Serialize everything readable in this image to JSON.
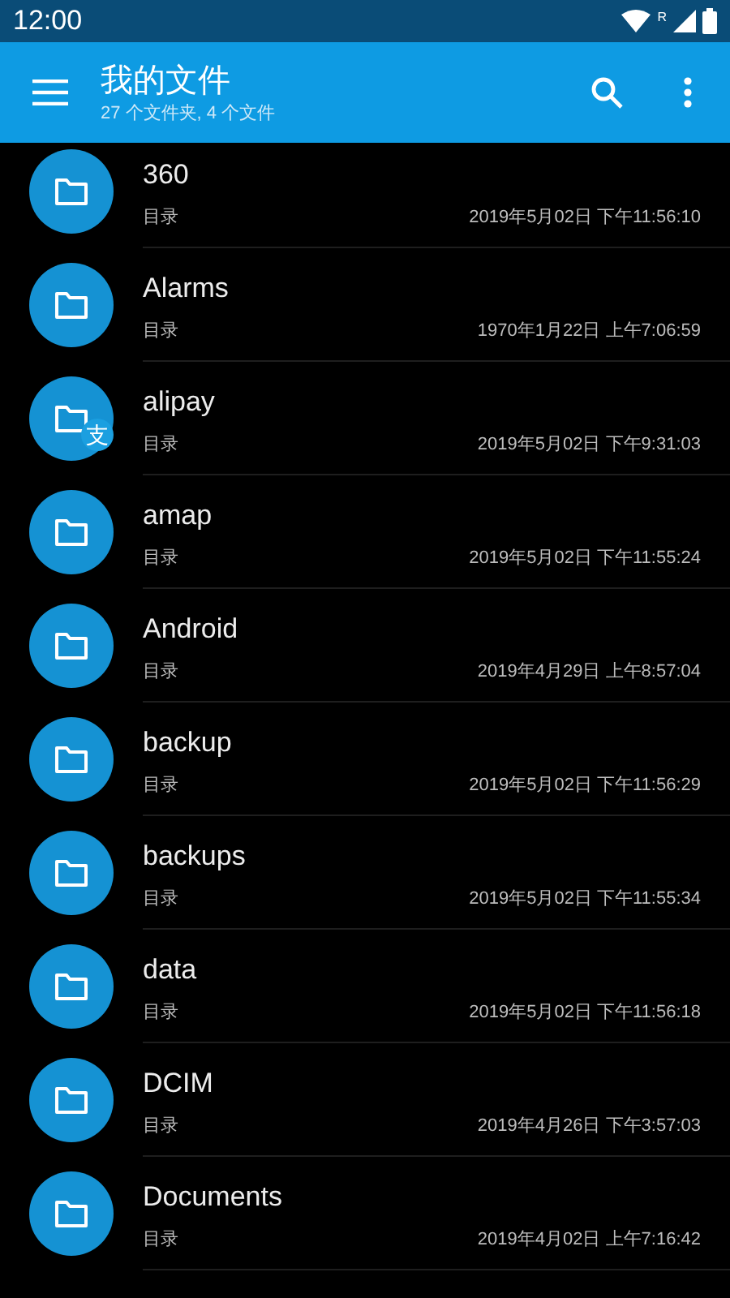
{
  "status_bar": {
    "time": "12:00",
    "roaming": "R"
  },
  "toolbar": {
    "title": "我的文件",
    "subtitle": "27 个文件夹, 4 个文件"
  },
  "files": [
    {
      "name": "360",
      "type": "目录",
      "date": "2019年5月02日 下午11:56:10"
    },
    {
      "name": "Alarms",
      "type": "目录",
      "date": "1970年1月22日 上午7:06:59"
    },
    {
      "name": "alipay",
      "type": "目录",
      "date": "2019年5月02日 下午9:31:03",
      "badge": "支"
    },
    {
      "name": "amap",
      "type": "目录",
      "date": "2019年5月02日 下午11:55:24"
    },
    {
      "name": "Android",
      "type": "目录",
      "date": "2019年4月29日 上午8:57:04"
    },
    {
      "name": "backup",
      "type": "目录",
      "date": "2019年5月02日 下午11:56:29"
    },
    {
      "name": "backups",
      "type": "目录",
      "date": "2019年5月02日 下午11:55:34"
    },
    {
      "name": "data",
      "type": "目录",
      "date": "2019年5月02日 下午11:56:18"
    },
    {
      "name": "DCIM",
      "type": "目录",
      "date": "2019年4月26日 下午3:57:03"
    },
    {
      "name": "Documents",
      "type": "目录",
      "date": "2019年4月02日 上午7:16:42"
    }
  ]
}
